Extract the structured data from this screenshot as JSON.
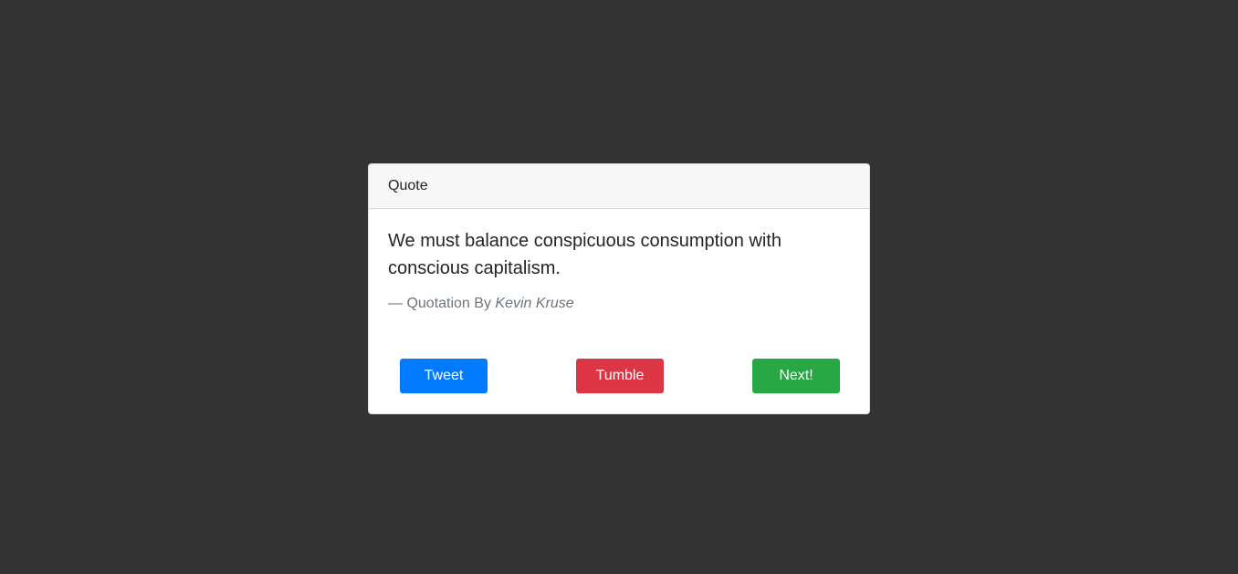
{
  "card": {
    "header": "Quote",
    "quote": "We must balance conspicuous consumption with conscious capitalism.",
    "attribution_prefix": "— Quotation By ",
    "author": "Kevin Kruse"
  },
  "buttons": {
    "tweet": "Tweet",
    "tumble": "Tumble",
    "next": "Next!"
  },
  "colors": {
    "background": "#333333",
    "tweet": "#007bff",
    "tumble": "#dc3545",
    "next": "#28a745"
  }
}
